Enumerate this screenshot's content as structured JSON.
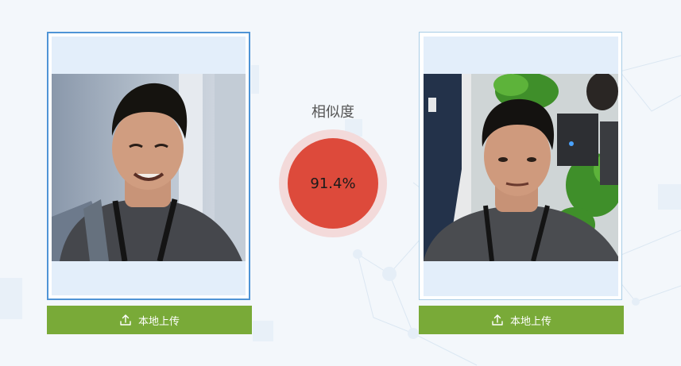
{
  "compare": {
    "similarity_label": "相似度",
    "similarity_score": "91.4%",
    "score_color": "#dd4a3b"
  },
  "left_panel": {
    "upload_label": "本地上传",
    "border_color": "#4f94d6"
  },
  "right_panel": {
    "upload_label": "本地上传",
    "border_color": "#a8cde6"
  },
  "theme": {
    "button_color": "#79aa38",
    "panel_fill": "#e3eefa"
  },
  "icons": {
    "upload": "upload-icon"
  }
}
